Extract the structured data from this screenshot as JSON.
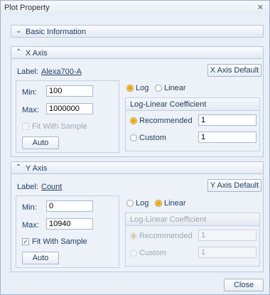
{
  "window": {
    "title": "Plot Property",
    "close_glyph": "✕"
  },
  "basic": {
    "title": "Basic Information"
  },
  "x_axis": {
    "title": "X Axis",
    "label_caption": "Label:",
    "label_value": "Alexa700-A",
    "default_button": "X Axis Default",
    "min_caption": "Min:",
    "min_value": "100",
    "max_caption": "Max:",
    "max_value": "1000000",
    "fit_caption": "Fit With Sample",
    "fit_checked": false,
    "auto_button": "Auto",
    "scale_log": "Log",
    "scale_linear": "Linear",
    "scale_selected": "Log",
    "coef_title": "Log-Linear Coefficient",
    "recommended_caption": "Recommended",
    "recommended_value": "1",
    "custom_caption": "Custom",
    "custom_value": "1",
    "coef_selected": "Recommended"
  },
  "y_axis": {
    "title": "Y Axis",
    "label_caption": "Label:",
    "label_value": "Count",
    "default_button": "Y Axis Default",
    "min_caption": "Min:",
    "min_value": "0",
    "max_caption": "Max:",
    "max_value": "10940",
    "fit_caption": "Fit With Sample",
    "fit_checked": true,
    "auto_button": "Auto",
    "scale_log": "Log",
    "scale_linear": "Linear",
    "scale_selected": "Linear",
    "coef_title": "Log-Linear Coefficient",
    "recommended_caption": "Recommended",
    "recommended_value": "1",
    "custom_caption": "Custom",
    "custom_value": "1",
    "coef_selected": "Recommended"
  },
  "footer": {
    "close_button": "Close"
  },
  "icons": {
    "expand": "chevron-up-icon",
    "collapse": "chevron-down-icon"
  },
  "colors": {
    "accent_radio": "#f0a500",
    "panel_bg": "#edf2f9",
    "text": "#1f3d66"
  }
}
